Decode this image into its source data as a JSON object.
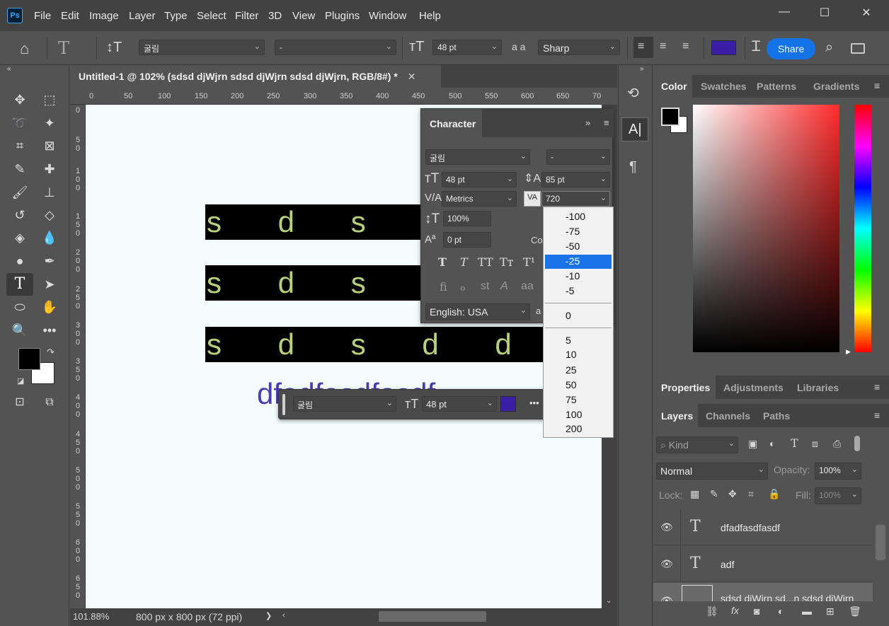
{
  "app": {
    "logo": "Ps",
    "menu": [
      "File",
      "Edit",
      "Image",
      "Layer",
      "Type",
      "Select",
      "Filter",
      "3D",
      "View",
      "Plugins",
      "Window",
      "Help"
    ]
  },
  "window_controls": {
    "minimize": "—",
    "maximize": "☐",
    "close": "✕"
  },
  "options_bar": {
    "font_family": "굴림",
    "font_style": "-",
    "font_size": "48 pt",
    "anti_alias_label": "a a",
    "anti_alias": "Sharp",
    "color": "#3a1fa6",
    "share_label": "Share"
  },
  "document": {
    "tab_title": "Untitled-1 @ 102% (sdsd djWjrn sdsd djWjrn sdsd djWjrn, RGB/8#) *",
    "ruler_h": [
      "0",
      "50",
      "100",
      "150",
      "200",
      "250",
      "300",
      "350",
      "400",
      "450",
      "500",
      "550",
      "600",
      "650",
      "70"
    ],
    "ruler_v": [
      "0",
      "5 0",
      "1 0 0",
      "1 5 0",
      "2 0 0",
      "2 5 0",
      "3 0 0",
      "3 5 0",
      "4 0 0",
      "4 5 0",
      "5 0 0",
      "5 5 0",
      "6 0 0",
      "6 5 0"
    ],
    "text_rows": [
      "s d s d d",
      "s d s d d",
      "s d s d d j W"
    ],
    "purple_text": "dfadfasdfasdf"
  },
  "status": {
    "zoom": "101.88%",
    "size": "800 px x 800 px (72 ppi)",
    "arrow": "❯"
  },
  "character_panel": {
    "title": "Character",
    "font_family": "굴림",
    "font_style": "-",
    "font_size": "48 pt",
    "leading": "85 pt",
    "kerning": "Metrics",
    "tracking": "720",
    "vertical_scale": "100%",
    "baseline_shift": "0 pt",
    "color_label": "Co",
    "language": "English: USA",
    "aa_label": "a"
  },
  "tracking_dropdown": {
    "options": [
      "-100",
      "-75",
      "-50",
      "-25",
      "-10",
      "-5",
      "0",
      "5",
      "10",
      "25",
      "50",
      "75",
      "100",
      "200"
    ],
    "selected": "-25"
  },
  "floating_bar": {
    "font_family": "굴림",
    "font_size": "48 pt",
    "color": "#3a1fa6",
    "more": "•••"
  },
  "color_panel": {
    "tabs": [
      "Color",
      "Swatches",
      "Patterns",
      "Gradients"
    ],
    "active": "Color",
    "fg": "#000000",
    "bg": "#ffffff"
  },
  "properties_panel": {
    "tabs": [
      "Properties",
      "Adjustments",
      "Libraries"
    ],
    "active": "Properties"
  },
  "layers_panel": {
    "tabs": [
      "Layers",
      "Channels",
      "Paths"
    ],
    "active": "Layers",
    "search_placeholder": "Kind",
    "blend_mode": "Normal",
    "opacity_label": "Opacity:",
    "opacity": "100%",
    "lock_label": "Lock:",
    "fill_label": "Fill:",
    "fill": "100%",
    "layers": [
      "dfadfasdfasdf",
      "adf",
      "sdsd djWjrn sd...n sdsd djWjrn"
    ]
  }
}
